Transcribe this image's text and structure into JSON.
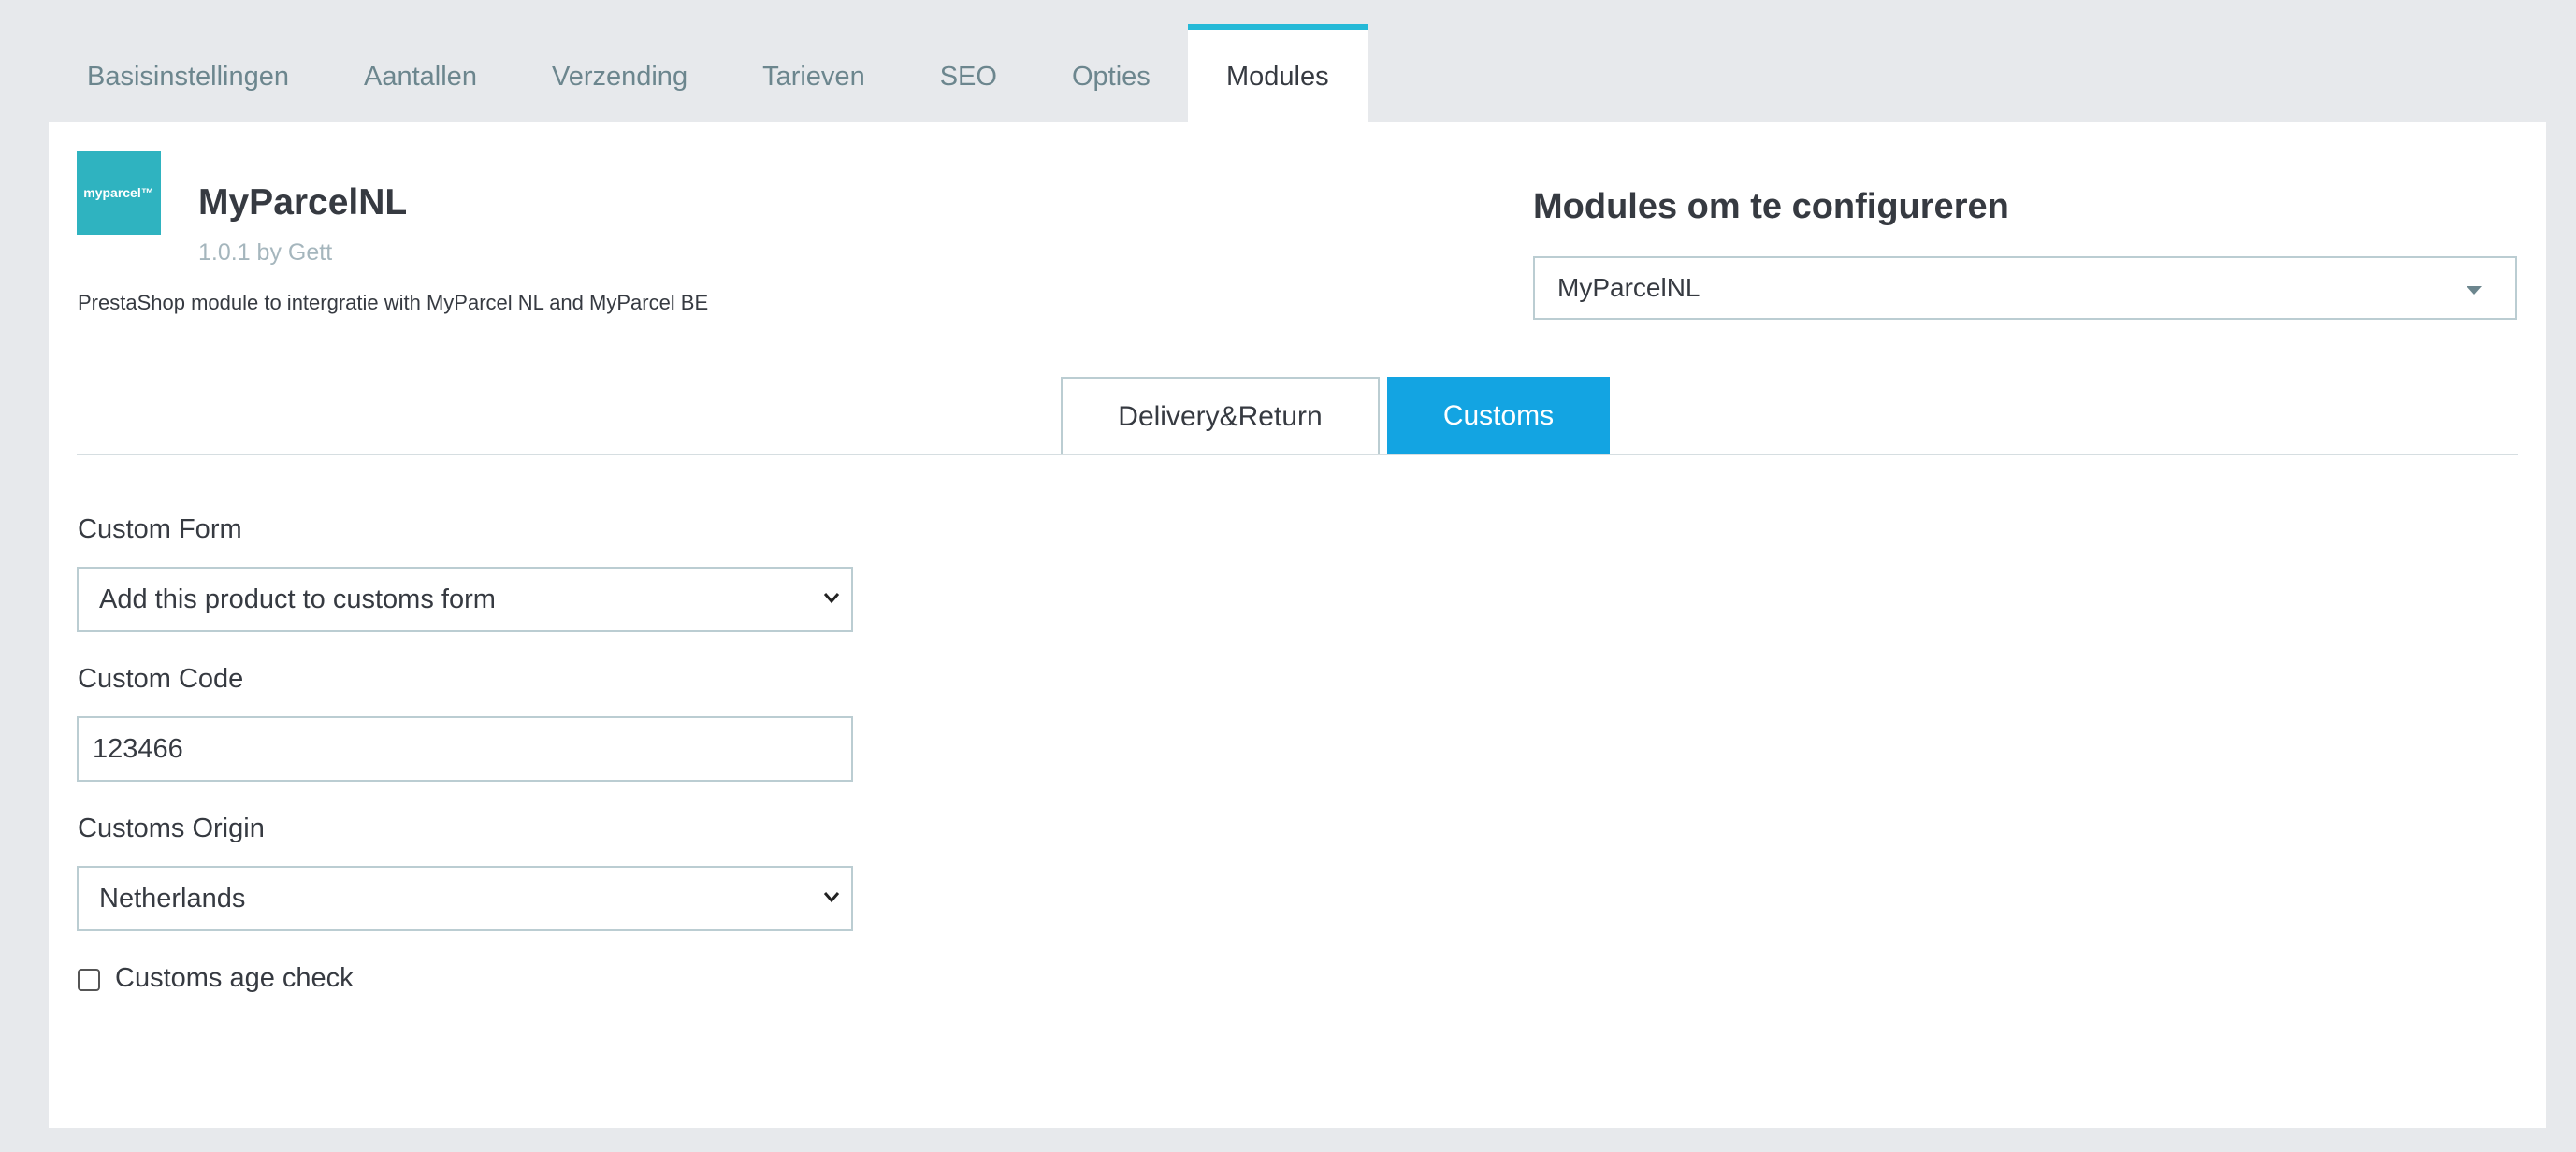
{
  "tabs": [
    {
      "label": "Basisinstellingen",
      "active": false
    },
    {
      "label": "Aantallen",
      "active": false
    },
    {
      "label": "Verzending",
      "active": false
    },
    {
      "label": "Tarieven",
      "active": false
    },
    {
      "label": "SEO",
      "active": false
    },
    {
      "label": "Opties",
      "active": false
    },
    {
      "label": "Modules",
      "active": true
    }
  ],
  "module": {
    "logo_text": "myparcel™",
    "name": "MyParcelNL",
    "version": "1.0.1 by Gett",
    "description": "PrestaShop module to intergratie with MyParcel NL and MyParcel BE"
  },
  "configure": {
    "title": "Modules om te configureren",
    "selected": "MyParcelNL"
  },
  "subtabs": {
    "delivery_return": "Delivery&Return",
    "customs": "Customs",
    "active": "Customs"
  },
  "form": {
    "custom_form_label": "Custom Form",
    "custom_form_value": "Add this product to customs form",
    "custom_code_label": "Custom Code",
    "custom_code_value": "123466",
    "customs_origin_label": "Customs Origin",
    "customs_origin_value": "Netherlands",
    "age_check_label": "Customs age check",
    "age_check_checked": false
  },
  "colors": {
    "accent": "#25b9d7",
    "active_subtab": "#13a4e2",
    "logo_bg": "#2fb3c0",
    "background": "#e7e9ec"
  }
}
